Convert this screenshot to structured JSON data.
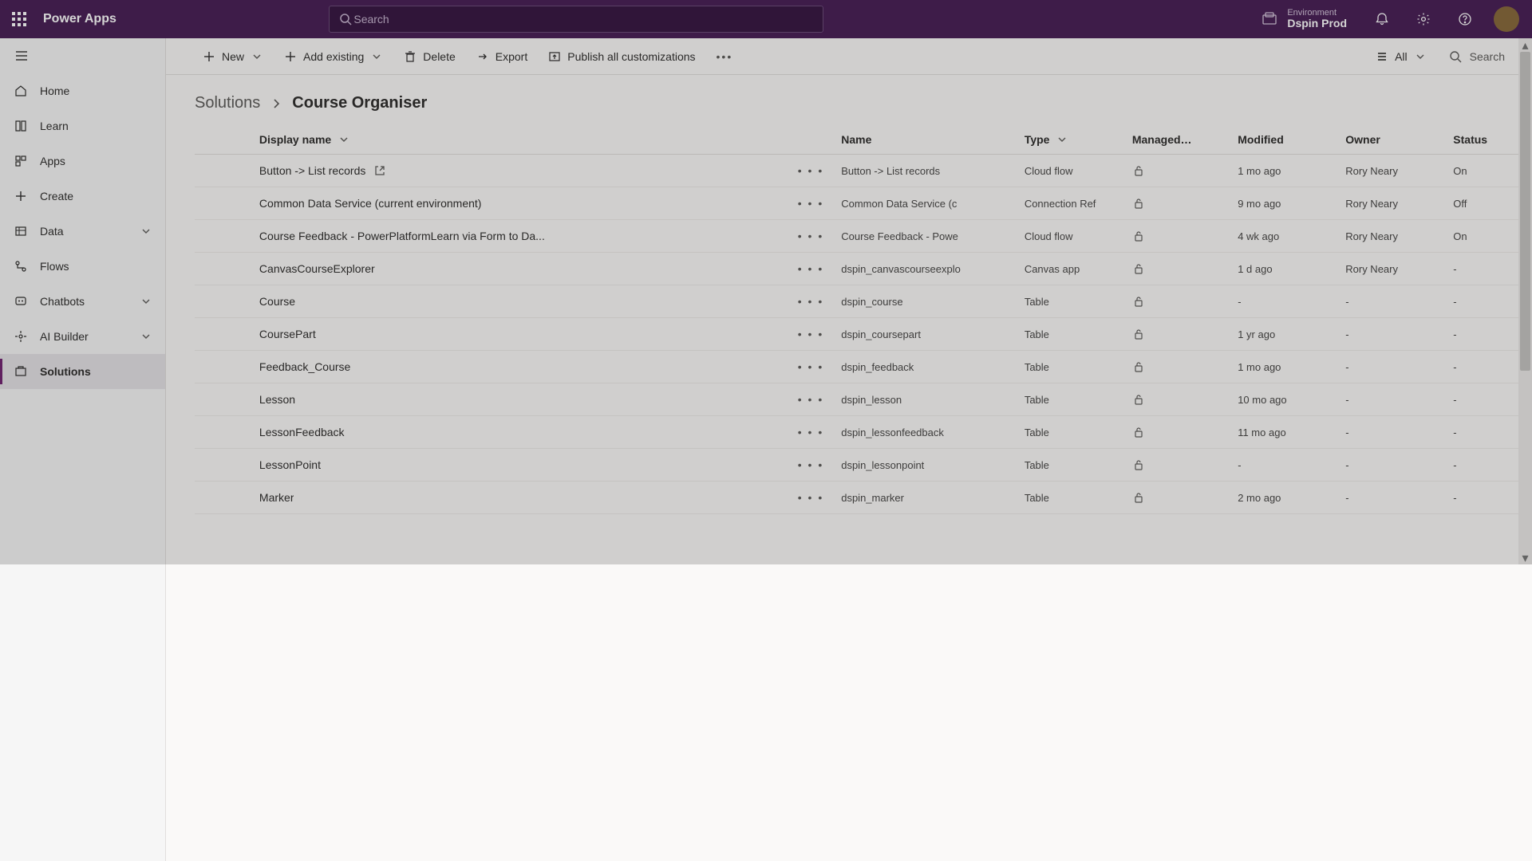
{
  "app_title": "Power Apps",
  "search_placeholder": "Search",
  "environment": {
    "label": "Environment",
    "name": "Dspin Prod"
  },
  "nav": {
    "items": [
      {
        "label": "Home"
      },
      {
        "label": "Learn"
      },
      {
        "label": "Apps"
      },
      {
        "label": "Create"
      },
      {
        "label": "Data",
        "expandable": true
      },
      {
        "label": "Flows"
      },
      {
        "label": "Chatbots",
        "expandable": true
      },
      {
        "label": "AI Builder",
        "expandable": true
      },
      {
        "label": "Solutions",
        "active": true
      }
    ]
  },
  "cmdbar": {
    "new_label": "New",
    "add_existing_label": "Add existing",
    "delete_label": "Delete",
    "export_label": "Export",
    "publish_label": "Publish all customizations",
    "filter_label": "All",
    "search_label": "Search"
  },
  "breadcrumb": {
    "root": "Solutions",
    "current": "Course Organiser"
  },
  "columns": {
    "display_name": "Display name",
    "name": "Name",
    "type": "Type",
    "managed": "Managed…",
    "modified": "Modified",
    "owner": "Owner",
    "status": "Status"
  },
  "rows": [
    {
      "display": "Button -> List records",
      "openable": true,
      "name": "Button -> List records",
      "type": "Cloud flow",
      "modified": "1 mo ago",
      "owner": "Rory Neary",
      "status": "On"
    },
    {
      "display": "Common Data Service (current environment)",
      "openable": false,
      "name": "Common Data Service (c",
      "type": "Connection Ref",
      "modified": "9 mo ago",
      "owner": "Rory Neary",
      "status": "Off"
    },
    {
      "display": "Course Feedback - PowerPlatformLearn via Form to Da...",
      "openable": false,
      "name": "Course Feedback - Powe",
      "type": "Cloud flow",
      "modified": "4 wk ago",
      "owner": "Rory Neary",
      "status": "On"
    },
    {
      "display": "CanvasCourseExplorer",
      "openable": false,
      "name": "dspin_canvascourseexplo",
      "type": "Canvas app",
      "modified": "1 d ago",
      "owner": "Rory Neary",
      "status": "-"
    },
    {
      "display": "Course",
      "openable": false,
      "name": "dspin_course",
      "type": "Table",
      "modified": "-",
      "owner": "-",
      "status": "-"
    },
    {
      "display": "CoursePart",
      "openable": false,
      "name": "dspin_coursepart",
      "type": "Table",
      "modified": "1 yr ago",
      "owner": "-",
      "status": "-"
    },
    {
      "display": "Feedback_Course",
      "openable": false,
      "name": "dspin_feedback",
      "type": "Table",
      "modified": "1 mo ago",
      "owner": "-",
      "status": "-"
    },
    {
      "display": "Lesson",
      "openable": false,
      "name": "dspin_lesson",
      "type": "Table",
      "modified": "10 mo ago",
      "owner": "-",
      "status": "-"
    },
    {
      "display": "LessonFeedback",
      "openable": false,
      "name": "dspin_lessonfeedback",
      "type": "Table",
      "modified": "11 mo ago",
      "owner": "-",
      "status": "-"
    },
    {
      "display": "LessonPoint",
      "openable": false,
      "name": "dspin_lessonpoint",
      "type": "Table",
      "modified": "-",
      "owner": "-",
      "status": "-"
    },
    {
      "display": "Marker",
      "openable": false,
      "name": "dspin_marker",
      "type": "Table",
      "modified": "2 mo ago",
      "owner": "-",
      "status": "-"
    }
  ]
}
